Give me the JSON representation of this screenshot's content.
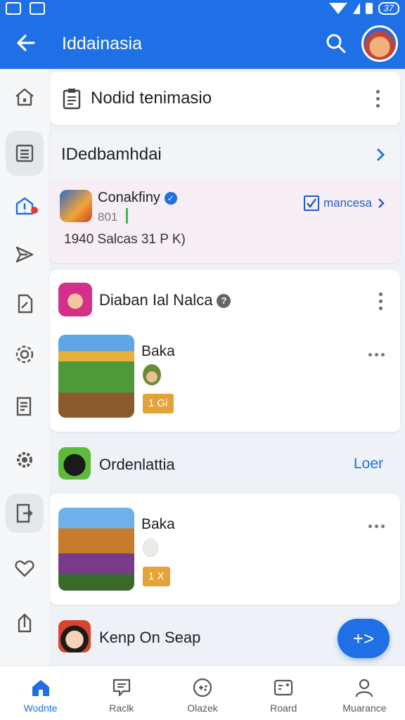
{
  "status_bar": {
    "battery_text": "37"
  },
  "app_bar": {
    "title": "Iddainasia"
  },
  "rail": {
    "items": [
      {
        "icon": "home-icon"
      },
      {
        "icon": "list-icon",
        "active": true
      },
      {
        "icon": "alert-icon",
        "badge": true
      },
      {
        "icon": "send-icon"
      },
      {
        "icon": "edit-icon"
      },
      {
        "icon": "settings-icon"
      },
      {
        "icon": "notes-icon"
      },
      {
        "icon": "gear-icon"
      },
      {
        "icon": "export-icon"
      },
      {
        "icon": "heart-icon"
      },
      {
        "icon": "share-icon"
      }
    ]
  },
  "card_notice": {
    "text": "Nodid tenimasio"
  },
  "card_section": {
    "header": "IDedbamhdai",
    "app": {
      "name": "Conakfiny",
      "sub": "801",
      "stats": "1940 Salcas 31 P K)",
      "manage_label": "mancesa"
    }
  },
  "card_post": {
    "name": "Diaban Ial Nalca",
    "item": {
      "title": "Baka",
      "badge": "1 Gi"
    }
  },
  "row_open": {
    "name": "Ordenlattia",
    "more": "Loer"
  },
  "card_item2": {
    "title": "Baka",
    "badge": "1 X"
  },
  "row_last": {
    "name": "Kenp On Seap"
  },
  "fab": {
    "label": "+>"
  },
  "bottom_nav": {
    "items": [
      {
        "label": "Wodnte",
        "icon": "home-icon",
        "active": true
      },
      {
        "label": "Raclk",
        "icon": "message-icon"
      },
      {
        "label": "Olazek",
        "icon": "gamepad-icon"
      },
      {
        "label": "Roard",
        "icon": "board-icon"
      },
      {
        "label": "Muarance",
        "icon": "person-icon"
      }
    ]
  },
  "colors": {
    "primary": "#1f6fe6",
    "badge": "#e3a339",
    "alert": "#e53935"
  }
}
